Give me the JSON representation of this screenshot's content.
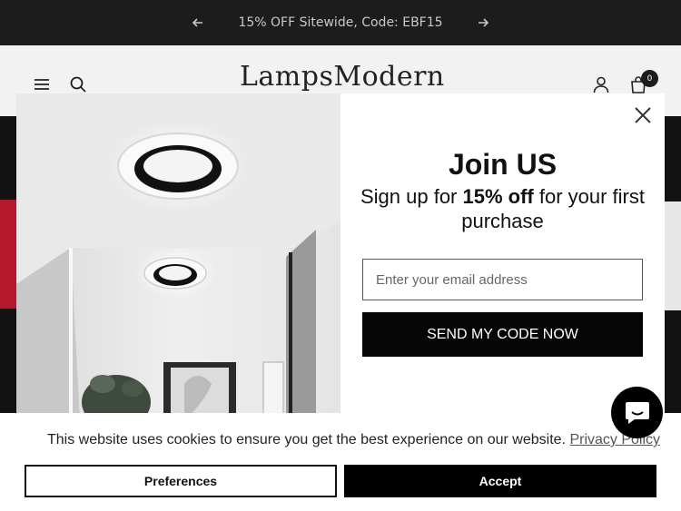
{
  "announcement": {
    "text": "15% OFF Sitewide, Code: EBF15"
  },
  "header": {
    "logo": "LampsModern",
    "cart_count": "0"
  },
  "modal": {
    "title": "Join US",
    "subtitle_pre": "Sign up for ",
    "subtitle_bold": "15% off",
    "subtitle_post": " for your first purchase",
    "email_placeholder": "Enter your email address",
    "submit_label": "SEND MY CODE NOW"
  },
  "cookie": {
    "text": "This website uses cookies to ensure you get the best experience on our website. ",
    "policy_link": "Privacy Policy",
    "preferences_label": "Preferences",
    "accept_label": "Accept"
  },
  "colors": {
    "dark": "#1c1c1c",
    "header_bg": "#f2f2f2",
    "promo_red": "#b3182b"
  }
}
